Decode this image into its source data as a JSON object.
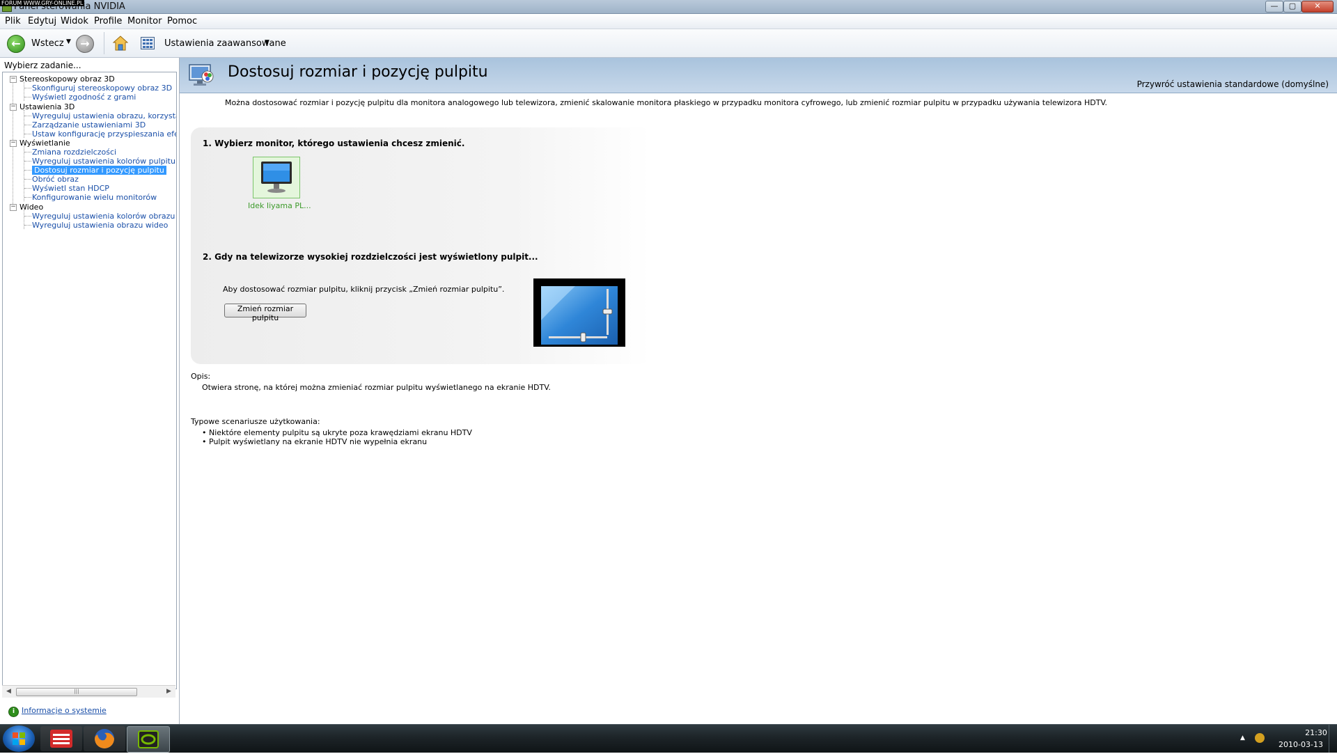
{
  "window": {
    "title": "Panel sterowania NVIDIA",
    "watermark": "FORUM WWW.GRY-ONLINE.PL",
    "minimize_glyph": "—",
    "maximize_glyph": "▢",
    "close_glyph": "✕"
  },
  "menu": {
    "items": [
      "Plik",
      "Edytuj",
      "Widok",
      "Profile",
      "Monitor",
      "Pomoc"
    ]
  },
  "toolbar": {
    "back_label": "Wstecz",
    "back_glyph": "←",
    "forward_glyph": "→",
    "dropdown_glyph": "▼",
    "advanced_label": "Ustawienia zaawansowane"
  },
  "sidebar": {
    "header": "Wybierz zadanie...",
    "categories": [
      {
        "label": "Stereoskopowy obraz 3D",
        "items": [
          "Skonfiguruj stereoskopowy obraz 3D",
          "Wyświetl zgodność z grami"
        ]
      },
      {
        "label": "Ustawienia 3D",
        "items": [
          "Wyreguluj ustawienia obrazu, korzystając z podglądu",
          "Zarządzanie ustawieniami 3D",
          "Ustaw konfigurację przyspieszania efektów PhysX"
        ]
      },
      {
        "label": "Wyświetlanie",
        "items": [
          "Zmiana rozdzielczości",
          "Wyreguluj ustawienia kolorów pulpitu",
          "Dostosuj rozmiar i pozycję pulpitu",
          "Obróć obraz",
          "Wyświetl stan HDCP",
          "Konfigurowanie wielu monitorów"
        ]
      },
      {
        "label": "Wideo",
        "items": [
          "Wyreguluj ustawienia kolorów obrazu wideo",
          "Wyreguluj ustawienia obrazu wideo"
        ]
      }
    ],
    "expander_glyph": "−",
    "scroll_left": "◀",
    "scroll_right": "▶",
    "scroll_grip": "|||",
    "system_info": "Informacje o systemie"
  },
  "content": {
    "title": "Dostosuj rozmiar i pozycję pulpitu",
    "restore_defaults": "Przywróć ustawienia standardowe (domyślne)",
    "intro": "Można dostosować rozmiar i pozycję pulpitu dla monitora analogowego lub telewizora, zmienić skalowanie monitora płaskiego w przypadku monitora cyfrowego, lub zmienić rozmiar pulpitu w przypadku używania telewizora HDTV.",
    "step1": "1. Wybierz monitor, którego ustawienia chcesz zmienić.",
    "monitor_name": "Idek Iiyama PL...",
    "step2": "2. Gdy na telewizorze wysokiej rozdzielczości jest wyświetlony pulpit...",
    "resize_hint": "Aby dostosować rozmiar pulpitu, kliknij przycisk „Zmień rozmiar pulpitu”.",
    "resize_button": "Zmień rozmiar pulpitu",
    "description_label": "Opis:",
    "description": "Otwiera stronę, na której można zmieniać rozmiar pulpitu wyświetlanego na ekranie HDTV.",
    "usage_label": "Typowe scenariusze użytkowania:",
    "usage": [
      "Niektóre elementy pulpitu są ukryte poza krawędziami ekranu HDTV",
      "Pulpit wyświetlany na ekranie HDTV nie wypełnia ekranu"
    ]
  },
  "taskbar": {
    "tray_arrow": "▲",
    "time": "21:30",
    "date": "2010-03-13"
  },
  "colors": {
    "link": "#1a4fa8",
    "selected": "#3399ff",
    "monitor_name": "#3c9a2a",
    "header_gradient_top": "#a9c3dd"
  }
}
